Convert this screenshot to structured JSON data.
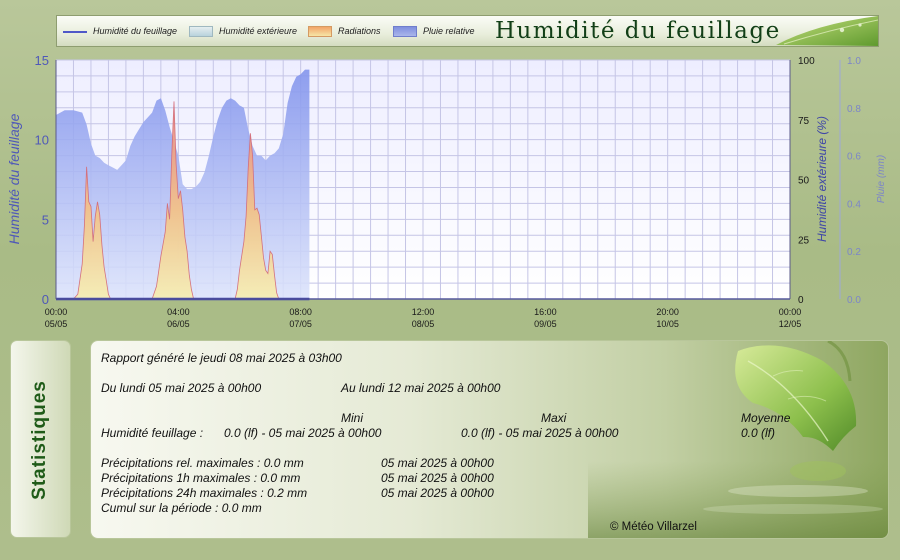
{
  "legend": [
    {
      "label": "Humidité du feuillage",
      "color": "#4f58c8",
      "kind": "line"
    },
    {
      "label": "Humidité extérieure",
      "color": "#c7dce4",
      "kind": "area"
    },
    {
      "label": "Radiations",
      "color": "#f0b070",
      "kind": "area"
    },
    {
      "label": "Pluie relative",
      "color": "#8f9ee0",
      "kind": "area"
    }
  ],
  "title": "Humidité du feuillage",
  "chart_data": {
    "type": "area",
    "title": "Humidité du feuillage",
    "x_labels": [
      {
        "time": "00:00",
        "date": "05/05"
      },
      {
        "time": "04:00",
        "date": "06/05"
      },
      {
        "time": "08:00",
        "date": "07/05"
      },
      {
        "time": "12:00",
        "date": "08/05"
      },
      {
        "time": "16:00",
        "date": "09/05"
      },
      {
        "time": "20:00",
        "date": "10/05"
      },
      {
        "time": "00:00",
        "date": "12/05"
      }
    ],
    "x_hours_range": [
      0,
      168
    ],
    "y_left": {
      "label": "Humidité du feuillage",
      "range": [
        0,
        15
      ],
      "ticks": [
        "0",
        "5",
        "10",
        "15"
      ]
    },
    "y_right1": {
      "label": "Humidité extérieure (%)",
      "range": [
        0,
        100
      ],
      "ticks": [
        "0",
        "25",
        "50",
        "75",
        "100"
      ]
    },
    "y_right2": {
      "label": "Pluie (mm)",
      "range": [
        0,
        1
      ],
      "ticks": [
        "0.0",
        "0.2",
        "0.4",
        "0.6",
        "0.8",
        "1.0"
      ]
    },
    "grid": true,
    "series": [
      {
        "name": "Humidité extérieure",
        "axis": "right1",
        "color": "#8fa4ec",
        "points": [
          [
            0,
            77
          ],
          [
            2,
            79
          ],
          [
            4,
            79
          ],
          [
            6,
            78
          ],
          [
            7,
            73
          ],
          [
            8,
            65
          ],
          [
            9,
            60
          ],
          [
            10,
            59
          ],
          [
            11,
            57
          ],
          [
            12,
            56
          ],
          [
            13,
            55
          ],
          [
            14,
            54
          ],
          [
            15,
            56
          ],
          [
            16,
            58
          ],
          [
            17,
            64
          ],
          [
            18,
            68
          ],
          [
            19,
            71
          ],
          [
            20,
            74
          ],
          [
            21,
            76
          ],
          [
            22,
            78
          ],
          [
            23,
            83
          ],
          [
            24,
            84
          ],
          [
            25,
            79
          ],
          [
            26,
            72
          ],
          [
            27,
            66
          ],
          [
            28,
            60
          ],
          [
            29,
            48
          ],
          [
            30,
            46
          ],
          [
            31,
            46
          ],
          [
            32,
            47
          ],
          [
            33,
            49
          ],
          [
            34,
            53
          ],
          [
            35,
            60
          ],
          [
            36,
            68
          ],
          [
            37,
            75
          ],
          [
            38,
            80
          ],
          [
            39,
            83
          ],
          [
            40,
            84
          ],
          [
            41,
            83
          ],
          [
            42,
            81
          ],
          [
            43,
            80
          ],
          [
            44,
            71
          ],
          [
            45,
            64
          ],
          [
            46,
            60
          ],
          [
            47,
            60
          ],
          [
            48,
            58
          ],
          [
            49,
            60
          ],
          [
            50,
            61
          ],
          [
            51,
            63
          ],
          [
            52,
            69
          ],
          [
            53,
            82
          ],
          [
            54,
            89
          ],
          [
            55,
            93
          ],
          [
            56,
            94
          ],
          [
            57,
            96
          ],
          [
            58,
            96
          ]
        ]
      },
      {
        "name": "Radiations",
        "axis": "left",
        "color": "#f0a868",
        "points": [
          [
            0,
            0
          ],
          [
            4,
            0
          ],
          [
            5,
            0.3
          ],
          [
            6,
            2.2
          ],
          [
            6.5,
            4.6
          ],
          [
            7,
            8.3
          ],
          [
            7.5,
            6.1
          ],
          [
            8,
            5.8
          ],
          [
            8.5,
            3.6
          ],
          [
            9,
            5.2
          ],
          [
            9.5,
            6.1
          ],
          [
            10,
            5.3
          ],
          [
            10.5,
            3.4
          ],
          [
            11,
            2.0
          ],
          [
            11.5,
            1.2
          ],
          [
            12,
            0.3
          ],
          [
            12.5,
            0
          ],
          [
            22,
            0
          ],
          [
            23,
            0.8
          ],
          [
            24,
            2.7
          ],
          [
            25,
            4.2
          ],
          [
            25.5,
            6.0
          ],
          [
            26,
            5.0
          ],
          [
            26.5,
            9.1
          ],
          [
            27,
            12.4
          ],
          [
            27.5,
            8.5
          ],
          [
            28,
            6.3
          ],
          [
            28.5,
            6.8
          ],
          [
            29,
            5.6
          ],
          [
            29.5,
            3.9
          ],
          [
            30,
            3.0
          ],
          [
            30.5,
            1.5
          ],
          [
            31,
            0.6
          ],
          [
            31.5,
            0
          ],
          [
            41,
            0
          ],
          [
            41.5,
            0.6
          ],
          [
            42,
            1.8
          ],
          [
            43,
            3.6
          ],
          [
            43.5,
            5.2
          ],
          [
            44,
            8.2
          ],
          [
            44.5,
            10.4
          ],
          [
            45,
            9.0
          ],
          [
            45.5,
            5.6
          ],
          [
            46,
            5.7
          ],
          [
            46.5,
            5.3
          ],
          [
            47,
            4.0
          ],
          [
            47.5,
            2.6
          ],
          [
            48,
            1.8
          ],
          [
            48.5,
            1.6
          ],
          [
            49,
            3.0
          ],
          [
            49.5,
            2.8
          ],
          [
            50,
            1.5
          ],
          [
            50.5,
            0.4
          ],
          [
            51,
            0
          ]
        ]
      },
      {
        "name": "Pluie relative",
        "axis": "right2",
        "color": "#4f58c8",
        "points": [
          [
            0,
            0
          ],
          [
            168,
            0
          ]
        ]
      },
      {
        "name": "Humidité du feuillage",
        "axis": "left",
        "color": "#3a3fb0",
        "points": [
          [
            0,
            0
          ],
          [
            58,
            0
          ]
        ]
      }
    ]
  },
  "stats": {
    "side_label": "Statistiques",
    "report": "Rapport généré le jeudi 08 mai 2025 à 03h00",
    "from": "Du lundi 05 mai 2025 à 00h00",
    "to": "Au lundi 12 mai 2025 à 00h00",
    "col_min": "Mini",
    "col_max": "Maxi",
    "col_avg": "Moyenne",
    "row_label": "Humidité feuillage :",
    "row_min": "0.0 (lf) - 05 mai 2025 à 00h00",
    "row_max": "0.0 (lf) - 05 mai 2025 à 00h00",
    "row_avg": "0.0 (lf)",
    "precip": [
      {
        "label": "Précipitations rel. maximales : 0.0 mm",
        "date": "05 mai 2025 à 00h00"
      },
      {
        "label": "Précipitations 1h maximales : 0.0 mm",
        "date": "05 mai 2025 à 00h00"
      },
      {
        "label": "Précipitations 24h maximales : 0.2 mm",
        "date": "05 mai 2025 à 00h00"
      }
    ],
    "cumul": "Cumul sur la période : 0.0 mm",
    "copyright": "© Météo Villarzel"
  }
}
